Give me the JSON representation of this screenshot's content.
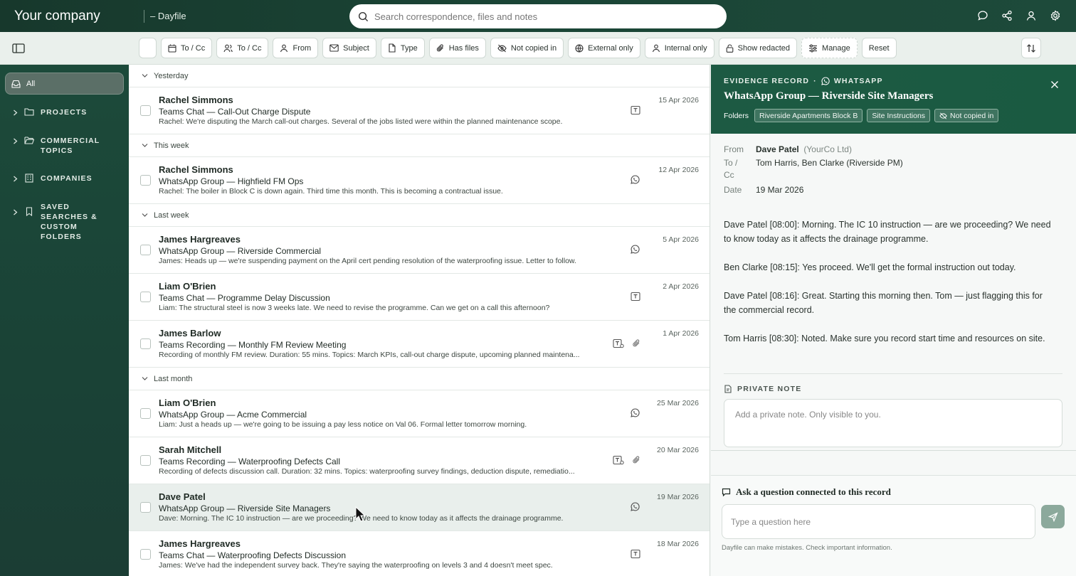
{
  "brand": "Your company",
  "product": "– Dayfile",
  "search": {
    "placeholder": "Search correspondence, files and notes"
  },
  "filters": [
    "Date",
    "To / Cc",
    "From",
    "Subject",
    "Type",
    "Has files",
    "Not copied in",
    "External only",
    "Internal only",
    "Show redacted",
    "Manage",
    "Reset"
  ],
  "sidebar": {
    "all": "All",
    "items": [
      {
        "label": "PROJECTS"
      },
      {
        "label": "COMMERCIAL TOPICS"
      },
      {
        "label": "COMPANIES"
      },
      {
        "label": "SAVED SEARCHES & CUSTOM FOLDERS"
      }
    ]
  },
  "groups": [
    {
      "label": "Yesterday",
      "rows": [
        {
          "name": "Rachel Simmons",
          "subject": "Teams Chat — Call-Out Charge Dispute",
          "preview": "Rachel: We're disputing the March call-out charges. Several of the jobs listed were within the planned maintenance scope.",
          "date": "15 Apr 2026",
          "icon": "teams-icon"
        }
      ]
    },
    {
      "label": "This week",
      "rows": [
        {
          "name": "Rachel Simmons",
          "subject": "WhatsApp Group — Highfield FM Ops",
          "preview": "Rachel: The boiler in Block C is down again. Third time this month. This is becoming a contractual issue.",
          "date": "12 Apr 2026",
          "icon": "whatsapp-icon"
        }
      ]
    },
    {
      "label": "Last week",
      "rows": [
        {
          "name": "James Hargreaves",
          "subject": "WhatsApp Group — Riverside Commercial",
          "preview": "James: Heads up — we're suspending payment on the April cert pending resolution of the waterproofing issue. Letter to follow.",
          "date": "5 Apr 2026",
          "icon": "whatsapp-icon"
        },
        {
          "name": "Liam O'Brien",
          "subject": "Teams Chat — Programme Delay Discussion",
          "preview": "Liam: The structural steel is now 3 weeks late. We need to revise the programme. Can we get on a call this afternoon?",
          "date": "2 Apr 2026",
          "icon": "teams-icon"
        },
        {
          "name": "James Barlow",
          "subject": "Teams Recording — Monthly FM Review Meeting",
          "preview": "Recording of monthly FM review. Duration: 55 mins. Topics: March KPIs, call-out charge dispute, upcoming planned maintena...",
          "date": "1 Apr 2026",
          "icon": "teams-recording-icon",
          "attachment": true
        }
      ]
    },
    {
      "label": "Last month",
      "rows": [
        {
          "name": "Liam O'Brien",
          "subject": "WhatsApp Group — Acme Commercial",
          "preview": "Liam: Just a heads up — we're going to be issuing a pay less notice on Val 06. Formal letter tomorrow morning.",
          "date": "25 Mar 2026",
          "icon": "whatsapp-icon"
        },
        {
          "name": "Sarah Mitchell",
          "subject": "Teams Recording — Waterproofing Defects Call",
          "preview": "Recording of defects discussion call. Duration: 32 mins. Topics: waterproofing survey findings, deduction dispute, remediatio...",
          "date": "20 Mar 2026",
          "icon": "teams-recording-icon",
          "attachment": true
        },
        {
          "name": "Dave Patel",
          "subject": "WhatsApp Group — Riverside Site Managers",
          "preview": "Dave: Morning. The IC 10 instruction — are we proceeding? We need to know today as it affects the drainage programme.",
          "date": "19 Mar 2026",
          "icon": "whatsapp-icon",
          "selected": true
        },
        {
          "name": "James Hargreaves",
          "subject": "Teams Chat — Waterproofing Defects Discussion",
          "preview": "James: We've had the independent survey back. They're saying the waterproofing on levels 3 and 4 doesn't meet spec.",
          "date": "18 Mar 2026",
          "icon": "teams-icon"
        }
      ]
    }
  ],
  "detail": {
    "kicker": "EVIDENCE RECORD",
    "kicker_sep": "·",
    "channel": "WHATSAPP",
    "title": "WhatsApp Group — Riverside Site Managers",
    "folders_label": "Folders",
    "tags": [
      "Riverside Apartments Block B",
      "Site Instructions",
      "Not copied in"
    ],
    "from_label": "From",
    "from_name": "Dave Patel",
    "from_org": "(YourCo Ltd)",
    "to_label": "To / Cc",
    "to": "Tom Harris, Ben Clarke (Riverside PM)",
    "date_label": "Date",
    "date": "19 Mar 2026",
    "messages": [
      "Dave Patel [08:00]: Morning. The IC 10 instruction — are we proceeding? We need to know today as it affects the drainage programme.",
      "Ben Clarke [08:15]: Yes proceed. We'll get the formal instruction out today.",
      "Dave Patel [08:16]: Great. Starting this morning then. Tom — just flagging this for the commercial record.",
      "Tom Harris [08:30]: Noted. Make sure you record start time and resources on site."
    ],
    "private_note_label": "PRIVATE NOTE",
    "private_note_placeholder": "Add a private note. Only visible to you.",
    "ask_title": "Ask a question connected to this record",
    "ask_placeholder": "Type a question here",
    "disclaimer": "Dayfile can make mistakes. Check important information."
  }
}
